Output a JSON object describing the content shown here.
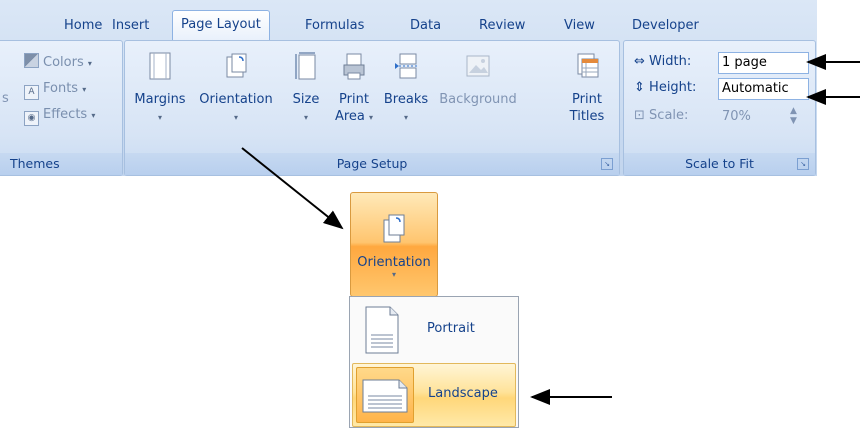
{
  "tabs": [
    "Home",
    "Insert",
    "Page Layout",
    "Formulas",
    "Data",
    "Review",
    "View",
    "Developer"
  ],
  "themes": {
    "cut_letter": "s",
    "colors": "Colors",
    "fonts": "Fonts",
    "effects": "Effects",
    "group_label": "Themes"
  },
  "page_setup": {
    "margins": "Margins",
    "orientation": "Orientation",
    "size": "Size",
    "print_area_line1": "Print",
    "print_area_line2": "Area",
    "breaks": "Breaks",
    "background": "Background",
    "print_titles_line1": "Print",
    "print_titles_line2": "Titles",
    "group_label": "Page Setup"
  },
  "scale_to_fit": {
    "width_label": "Width:",
    "width_value": "1 page",
    "height_label": "Height:",
    "height_value": "Automatic",
    "scale_label": "Scale:",
    "scale_value": "70%",
    "group_label": "Scale to Fit"
  },
  "orientation_popup": {
    "button_label": "Orientation",
    "items": [
      "Portrait",
      "Landscape"
    ]
  },
  "colors": {
    "ribbon_text": "#15428b",
    "hover_orange": "#ffc56f",
    "arrow": "#000000"
  }
}
